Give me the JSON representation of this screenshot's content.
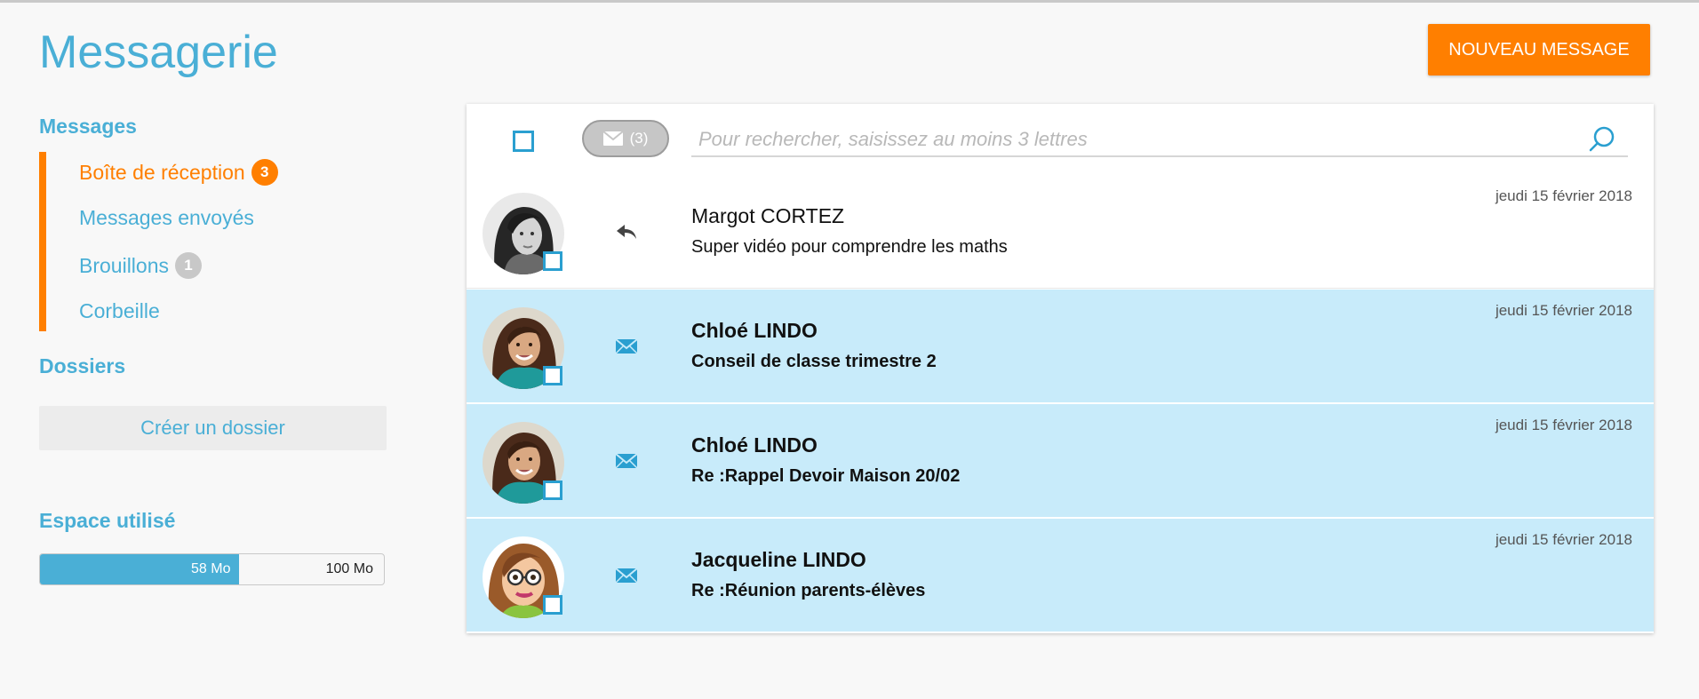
{
  "header": {
    "title": "Messagerie",
    "new_message_label": "NOUVEAU MESSAGE"
  },
  "sidebar": {
    "messages_title": "Messages",
    "items": [
      {
        "label": "Boîte de réception",
        "badge": "3",
        "active": true
      },
      {
        "label": "Messages envoyés",
        "badge": ""
      },
      {
        "label": "Brouillons",
        "badge": "1"
      },
      {
        "label": "Corbeille",
        "badge": ""
      }
    ],
    "folders_title": "Dossiers",
    "create_folder_label": "Créer un dossier",
    "storage_title": "Espace utilisé",
    "storage_used": "58 Mo",
    "storage_total": "100 Mo",
    "storage_fraction": 0.58
  },
  "toolbar": {
    "unread_count": "(3)",
    "search_placeholder": "Pour rechercher, saisissez au moins 3 lettres",
    "search_value": ""
  },
  "messages": [
    {
      "sender": "Margot CORTEZ",
      "subject": "Super vidéo pour comprendre les maths",
      "date": "jeudi 15 février 2018",
      "unread": false,
      "status_icon": "reply-icon",
      "avatar": "photo-girl-bw"
    },
    {
      "sender": "Chloé LINDO",
      "subject": "Conseil de classe trimestre 2",
      "date": "jeudi 15 février 2018",
      "unread": true,
      "status_icon": "envelope-icon",
      "avatar": "photo-girl-teal"
    },
    {
      "sender": "Chloé LINDO",
      "subject": "Re :Rappel Devoir Maison 20/02",
      "date": "jeudi 15 février 2018",
      "unread": true,
      "status_icon": "envelope-icon",
      "avatar": "photo-girl-teal"
    },
    {
      "sender": "Jacqueline LINDO",
      "subject": "Re :Réunion parents-élèves",
      "date": "jeudi 15 février 2018",
      "unread": true,
      "status_icon": "envelope-icon",
      "avatar": "cartoon-woman-glasses"
    }
  ],
  "colors": {
    "brand_blue": "#4aafd6",
    "accent_orange": "#ff7f00",
    "unread_row": "#c8ebfa"
  }
}
